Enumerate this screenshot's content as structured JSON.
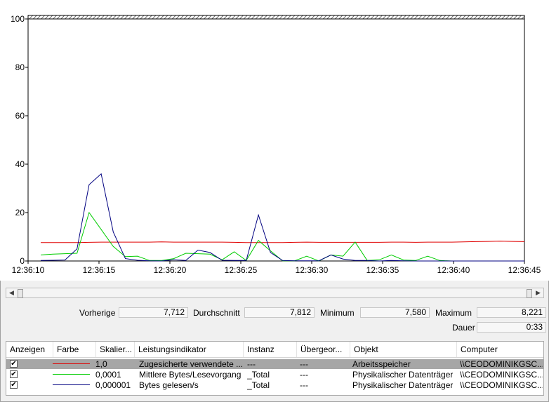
{
  "chart_data": {
    "type": "line",
    "ylim": [
      0,
      100
    ],
    "yticks": [
      "100",
      "80",
      "60",
      "40",
      "20",
      "0"
    ],
    "xlabels": [
      "12:36:10",
      "12:36:15",
      "12:36:20",
      "12:36:25",
      "12:36:30",
      "12:36:35",
      "12:36:40",
      "12:36:45"
    ],
    "grid": false,
    "series": [
      {
        "name": "Zugesicherte verwendete Bytes (%)",
        "color": "#e00000",
        "values": [
          7.6,
          7.6,
          7.6,
          7.6,
          7.7,
          7.8,
          7.8,
          7.8,
          7.8,
          7.8,
          7.9,
          7.8,
          7.8,
          7.8,
          7.8,
          7.8,
          7.7,
          7.6,
          7.6,
          7.6,
          7.6,
          7.7,
          7.8,
          7.7,
          7.7,
          7.7,
          7.7,
          7.7,
          7.7,
          7.8,
          7.8,
          7.7,
          7.8,
          7.8,
          7.8,
          7.9,
          8.0,
          8.1,
          8.2,
          8.1,
          8.0
        ]
      },
      {
        "name": "Mittlere Bytes/Lesevorgang",
        "color": "#00cc00",
        "values": [
          2.5,
          2.8,
          3.0,
          3.2,
          20.0,
          13.0,
          6.0,
          1.8,
          2.0,
          0.2,
          0.2,
          1.0,
          3.2,
          3.0,
          2.8,
          0.5,
          3.8,
          0.2,
          8.5,
          4.2,
          0.1,
          0.1,
          2.0,
          0.0,
          2.5,
          2.0,
          7.8,
          0.2,
          0.5,
          2.5,
          0.4,
          0.2,
          2.0,
          0.2,
          0.0,
          0.0,
          0.0,
          0.0,
          0.0,
          0.0,
          0.0
        ]
      },
      {
        "name": "Bytes gelesen/s",
        "color": "#000080",
        "values": [
          0.2,
          0.3,
          0.4,
          5.0,
          31.5,
          36.0,
          12.0,
          1.0,
          0.3,
          0.1,
          0.0,
          0.5,
          0.2,
          4.5,
          3.5,
          0.3,
          0.2,
          0.2,
          19.0,
          3.5,
          0.2,
          0.1,
          0.1,
          0.1,
          2.5,
          0.8,
          0.2,
          0.2,
          0.0,
          0.2,
          0.1,
          0.0,
          0.0,
          0.0,
          0.0,
          0.0,
          0.0,
          0.0,
          0.0,
          0.0,
          0.0
        ]
      }
    ]
  },
  "stats": {
    "previous_label": "Vorherige",
    "previous_value": "7,712",
    "average_label": "Durchschnitt",
    "average_value": "7,812",
    "min_label": "Minimum",
    "min_value": "7,580",
    "max_label": "Maximum",
    "max_value": "8,221",
    "duration_label": "Dauer",
    "duration_value": "0:33"
  },
  "legend": {
    "headers": [
      "Anzeigen",
      "Farbe",
      "Skalier...",
      "Leistungsindikator",
      "Instanz",
      "Übergeor...",
      "Objekt",
      "Computer"
    ],
    "rows": [
      {
        "checked": "✔",
        "color": "#e00000",
        "scale": "1,0",
        "counter": "Zugesicherte verwendete ...",
        "instance": "---",
        "parent": "---",
        "object": "Arbeitsspeicher",
        "computer": "\\\\CEODOMINIKGSC..."
      },
      {
        "checked": "✔",
        "color": "#00cc00",
        "scale": "0,0001",
        "counter": "Mittlere Bytes/Lesevorgang",
        "instance": "_Total",
        "parent": "---",
        "object": "Physikalischer Datenträger",
        "computer": "\\\\CEODOMINIKGSC..."
      },
      {
        "checked": "✔",
        "color": "#000080",
        "scale": "0,000001",
        "counter": "Bytes gelesen/s",
        "instance": "_Total",
        "parent": "---",
        "object": "Physikalischer Datenträger",
        "computer": "\\\\CEODOMINIKGSC..."
      }
    ]
  },
  "scrollbar": {
    "left_arrow": "◀",
    "right_arrow": "▶"
  }
}
